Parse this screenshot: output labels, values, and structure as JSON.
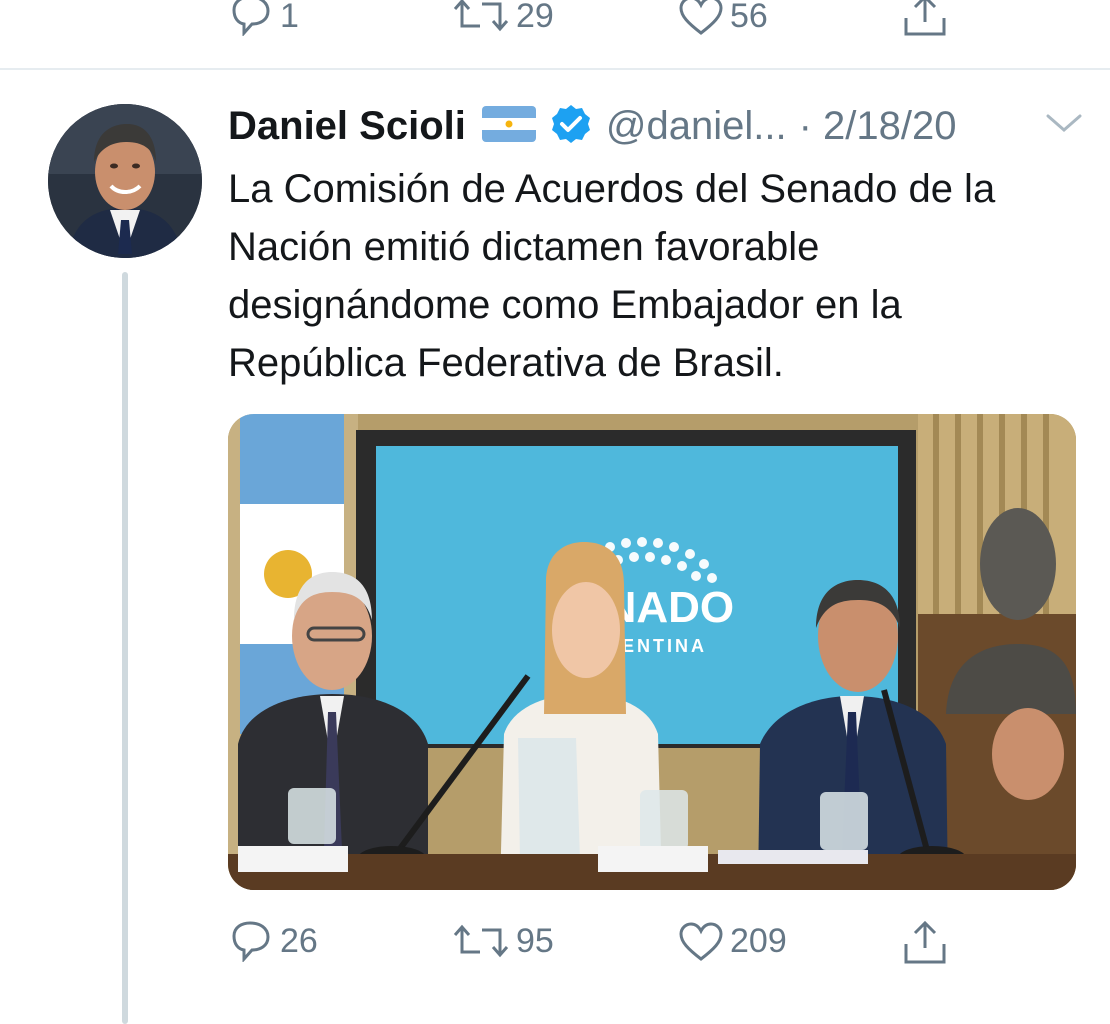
{
  "previous_tweet": {
    "actions": {
      "reply_count": "1",
      "retweet_count": "29",
      "like_count": "56"
    }
  },
  "tweet": {
    "author_name": "Daniel Scioli",
    "handle": "@daniel...",
    "date": "· 2/18/20",
    "text": "La Comisión de Acuerdos del Senado de la Nación emitió dictamen favorable designándome como Embajador en la República Federativa de Brasil.",
    "media": {
      "screen_text": "SENADO",
      "screen_subtext": "ARGENTINA"
    },
    "actions": {
      "reply_count": "26",
      "retweet_count": "95",
      "like_count": "209"
    }
  },
  "icons": {
    "reply": "speech-bubble-icon",
    "retweet": "retweet-arrows-icon",
    "like": "heart-icon",
    "share": "share-upload-icon",
    "verified": "verified-badge-icon",
    "flag": "argentina-flag-icon",
    "menu": "chevron-down-icon"
  },
  "colors": {
    "text": "#14171a",
    "secondary": "#657786",
    "verified": "#1da1f2",
    "thread_line": "#cfd9de"
  }
}
